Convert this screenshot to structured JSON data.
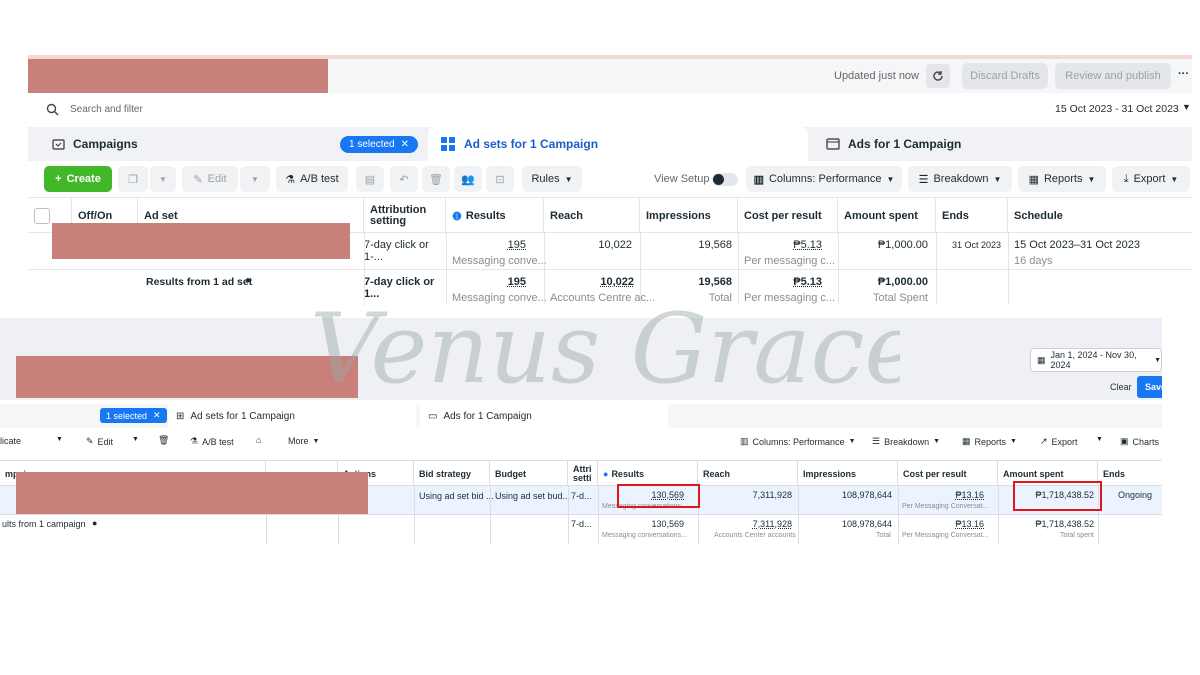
{
  "panel1": {
    "header": {
      "status": "Updated just now",
      "discard_label": "Discard Drafts",
      "review_label": "Review and publish",
      "more": "···"
    },
    "search": {
      "placeholder": "Search and filter"
    },
    "date_range": "15 Oct 2023 - 31 Oct 2023",
    "tabs": {
      "campaigns": "Campaigns",
      "selected": "1 selected",
      "adsets": "Ad sets for 1 Campaign",
      "ads": "Ads for 1 Campaign"
    },
    "toolbar": {
      "create": "Create",
      "edit": "Edit",
      "ab_test": "A/B test",
      "rules": "Rules",
      "view_setup": "View Setup",
      "columns": "Columns: Performance",
      "breakdown": "Breakdown",
      "reports": "Reports",
      "export": "Export"
    },
    "columns": {
      "off_on": "Off/On",
      "ad_set": "Ad set",
      "attribution": "Attribution setting",
      "results": "Results",
      "reach": "Reach",
      "impressions": "Impressions",
      "cost_per_result": "Cost per result",
      "amount_spent": "Amount spent",
      "ends": "Ends",
      "schedule": "Schedule"
    },
    "row1": {
      "attribution": "7-day click or 1-...",
      "results": "195",
      "results_sub": "Messaging conve...",
      "reach": "10,022",
      "impressions": "19,568",
      "cost": "₱5.13",
      "cost_sub": "Per messaging c...",
      "amount": "₱1,000.00",
      "ends": "31 Oct 2023",
      "schedule": "15 Oct 2023–31 Oct 2023",
      "schedule_sub": "16 days"
    },
    "summary": {
      "label": "Results from 1 ad set",
      "attribution": "7-day click or 1...",
      "results": "195",
      "results_sub": "Messaging conve...",
      "reach": "10,022",
      "reach_sub": "Accounts Centre ac...",
      "impressions": "19,568",
      "impressions_sub": "Total",
      "cost": "₱5.13",
      "cost_sub": "Per messaging c...",
      "amount": "₱1,000.00",
      "amount_sub": "Total Spent"
    }
  },
  "panel2": {
    "date_range": "Jan 1, 2024 - Nov 30, 2024",
    "clear": "Clear",
    "save": "Save",
    "tabs": {
      "selected": "1 selected",
      "adsets": "Ad sets for 1 Campaign",
      "ads": "Ads for 1 Campaign"
    },
    "toolbar": {
      "duplicate": "licate",
      "edit": "Edit",
      "ab_test": "A/B test",
      "more": "More",
      "columns": "Columns: Performance",
      "breakdown": "Breakdown",
      "reports": "Reports",
      "export": "Export",
      "charts": "Charts"
    },
    "columns": {
      "campaign": "mpaign",
      "actions": "Actions",
      "bid_strategy": "Bid strategy",
      "budget": "Budget",
      "attribution": "Attri setti",
      "results": "Results",
      "reach": "Reach",
      "impressions": "Impressions",
      "cost_per_result": "Cost per result",
      "amount_spent": "Amount spent",
      "ends": "Ends"
    },
    "row1": {
      "bid_strategy": "Using ad set bid ...",
      "budget": "Using ad set bud...",
      "attribution": "7-d...",
      "results": "130,569",
      "results_sub": "Messaging conversations",
      "reach": "7,311,928",
      "impressions": "108,978,644",
      "cost": "₱13.16",
      "cost_sub": "Per Messaging Conversat...",
      "amount": "₱1,718,438.52",
      "ends": "Ongoing"
    },
    "summary": {
      "label": "ults from 1 campaign",
      "attribution": "7-d...",
      "results": "130,569",
      "results_sub": "Messaging conversations...",
      "reach": "7,311,928",
      "reach_sub": "Accounts Center accounts",
      "impressions": "108,978,644",
      "impressions_sub": "Total",
      "cost": "₱13.16",
      "cost_sub": "Per Messaging Conversat...",
      "amount": "₱1,718,438.52",
      "amount_sub": "Total spent"
    }
  },
  "watermark": "Venus Grace",
  "colors": {
    "accent": "#1877f2",
    "create_green": "#42b72a",
    "highlight_red": "#e0161b",
    "redaction": "#c8807a"
  }
}
